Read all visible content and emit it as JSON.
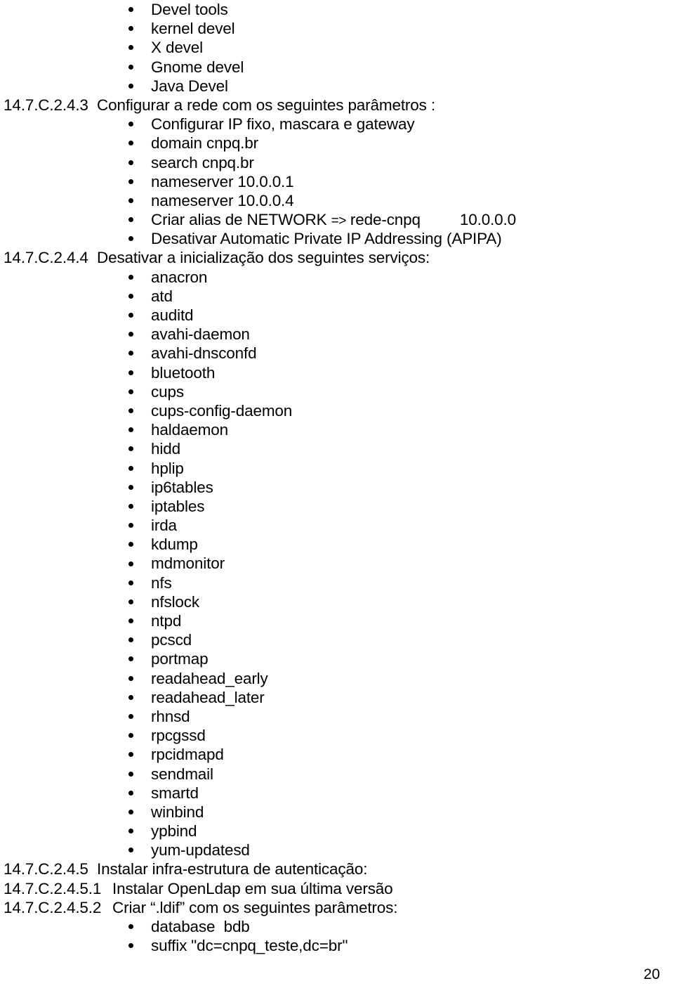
{
  "document": {
    "page_number": "20",
    "blocks": [
      {
        "kind": "bullet",
        "text": "Devel tools"
      },
      {
        "kind": "bullet",
        "text": "kernel devel"
      },
      {
        "kind": "bullet",
        "text": "X devel"
      },
      {
        "kind": "bullet",
        "text": "Gnome devel"
      },
      {
        "kind": "bullet",
        "text": "Java Devel"
      },
      {
        "kind": "heading",
        "number": "14.7.C.2.4.3",
        "text": "Configurar a rede com os seguintes parâmetros :"
      },
      {
        "kind": "bullet",
        "text": "Configurar IP fixo, mascara e gateway"
      },
      {
        "kind": "bullet",
        "text": "domain cnpq.br"
      },
      {
        "kind": "bullet",
        "text": "search cnpq.br"
      },
      {
        "kind": "bullet",
        "text": "nameserver 10.0.0.1"
      },
      {
        "kind": "bullet",
        "text": "nameserver 10.0.0.4"
      },
      {
        "kind": "bullet-alias",
        "prefix": "Criar alias de NETWORK ",
        "arrow": "=>",
        "middle": " rede-cnpq",
        "value": "10.0.0.0"
      },
      {
        "kind": "bullet",
        "text": "Desativar Automatic Private IP Addressing (APIPA)"
      },
      {
        "kind": "heading",
        "number": "14.7.C.2.4.4",
        "text": "Desativar a inicialização dos seguintes serviços:"
      },
      {
        "kind": "bullet",
        "text": "anacron"
      },
      {
        "kind": "bullet",
        "text": "atd"
      },
      {
        "kind": "bullet",
        "text": "auditd"
      },
      {
        "kind": "bullet",
        "text": "avahi-daemon"
      },
      {
        "kind": "bullet",
        "text": "avahi-dnsconfd"
      },
      {
        "kind": "bullet",
        "text": "bluetooth"
      },
      {
        "kind": "bullet",
        "text": "cups"
      },
      {
        "kind": "bullet",
        "text": "cups-config-daemon"
      },
      {
        "kind": "bullet",
        "text": "haldaemon"
      },
      {
        "kind": "bullet",
        "text": "hidd"
      },
      {
        "kind": "bullet",
        "text": "hplip"
      },
      {
        "kind": "bullet",
        "text": "ip6tables"
      },
      {
        "kind": "bullet",
        "text": "iptables"
      },
      {
        "kind": "bullet",
        "text": "irda"
      },
      {
        "kind": "bullet",
        "text": "kdump"
      },
      {
        "kind": "bullet",
        "text": "mdmonitor"
      },
      {
        "kind": "bullet",
        "text": "nfs"
      },
      {
        "kind": "bullet",
        "text": "nfslock"
      },
      {
        "kind": "bullet",
        "text": "ntpd"
      },
      {
        "kind": "bullet",
        "text": "pcscd"
      },
      {
        "kind": "bullet",
        "text": "portmap"
      },
      {
        "kind": "bullet",
        "text": "readahead_early"
      },
      {
        "kind": "bullet",
        "text": "readahead_later"
      },
      {
        "kind": "bullet",
        "text": "rhnsd"
      },
      {
        "kind": "bullet",
        "text": "rpcgssd"
      },
      {
        "kind": "bullet",
        "text": "rpcidmapd"
      },
      {
        "kind": "bullet",
        "text": "sendmail"
      },
      {
        "kind": "bullet",
        "text": "smartd"
      },
      {
        "kind": "bullet",
        "text": "winbind"
      },
      {
        "kind": "bullet",
        "text": "ypbind"
      },
      {
        "kind": "bullet",
        "text": "yum-updatesd"
      },
      {
        "kind": "heading",
        "number": "14.7.C.2.4.5",
        "text": "Instalar infra-estrutura de autenticação:"
      },
      {
        "kind": "heading",
        "number": "14.7.C.2.4.5.1",
        "wide": true,
        "text": "Instalar OpenLdap em sua última versão"
      },
      {
        "kind": "heading",
        "number": "14.7.C.2.4.5.2",
        "wide": true,
        "text": "Criar “.ldif” com os seguintes parâmetros:"
      },
      {
        "kind": "bullet",
        "text": "database  bdb"
      },
      {
        "kind": "bullet",
        "text": "suffix \"dc=cnpq_teste,dc=br\""
      }
    ]
  }
}
